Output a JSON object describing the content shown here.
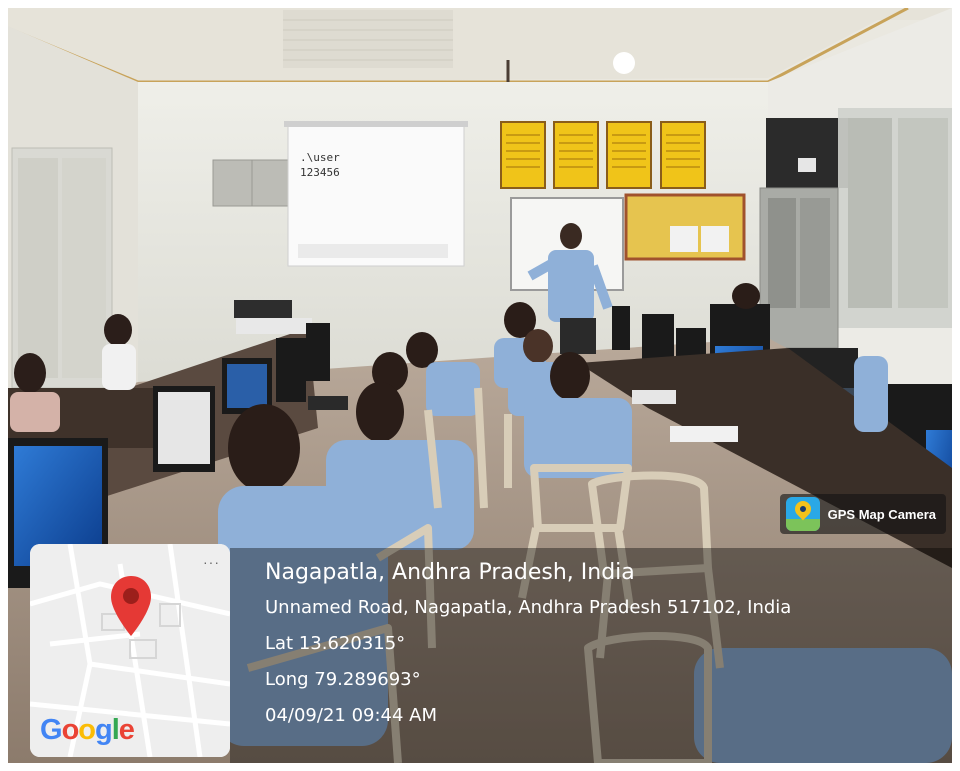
{
  "projector_screen": {
    "line1": ".\\user",
    "line2": "123456"
  },
  "app_badge": {
    "label": "GPS Map Camera",
    "logo_icon": "gps-map-camera-logo-icon"
  },
  "location": {
    "title": "Nagapatla, Andhra Pradesh, India",
    "address": "Unnamed Road, Nagapatla, Andhra Pradesh 517102, India",
    "latitude": "Lat 13.620315°",
    "longitude": "Long 79.289693°",
    "datetime": "04/09/21 09:44 AM"
  },
  "map_thumbnail": {
    "brand": {
      "G": "G",
      "o1": "o",
      "o2": "o",
      "g": "g",
      "l": "l",
      "e": "e"
    },
    "more_label": "···",
    "pin_color": "#e53935"
  },
  "colors": {
    "overlay": "#000000",
    "shirt": "#8fb0d8",
    "poster": "#f0c419",
    "wall": "#eeeeea"
  }
}
